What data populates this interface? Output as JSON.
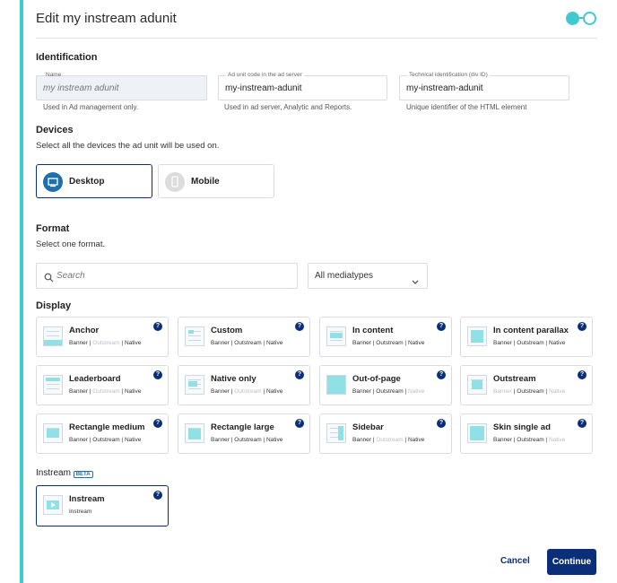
{
  "dialog": {
    "title": "Edit my instream adunit"
  },
  "identification": {
    "heading": "Identification",
    "name": {
      "label": "Name",
      "value": "my instream adunit",
      "help": "Used in Ad management only."
    },
    "ad_code": {
      "label": "Ad unit code in the ad server",
      "value": "my-instream-adunit",
      "help": "Used in ad server, Analytic and Reports."
    },
    "tech_id": {
      "label": "Technical identification (div ID)",
      "value": "my-instream-adunit",
      "help": "Unique identifier of the HTML element"
    }
  },
  "devices": {
    "heading": "Devices",
    "subtitle": "Select all the devices the ad unit will be used on.",
    "items": [
      {
        "label": "Desktop",
        "icon": "desktop-icon",
        "selected": true
      },
      {
        "label": "Mobile",
        "icon": "mobile-icon",
        "selected": false
      }
    ]
  },
  "format": {
    "heading": "Format",
    "subtitle": "Select one format.",
    "search_placeholder": "Search",
    "mediatype_select": "All mediatypes",
    "display_heading": "Display",
    "cards": [
      {
        "name": "Anchor",
        "types": [
          [
            "Banner",
            true
          ],
          [
            "Outstream",
            false
          ],
          [
            "Native",
            true
          ]
        ]
      },
      {
        "name": "Custom",
        "types": [
          [
            "Banner",
            true
          ],
          [
            "Outstream",
            true
          ],
          [
            "Native",
            true
          ]
        ]
      },
      {
        "name": "In content",
        "types": [
          [
            "Banner",
            true
          ],
          [
            "Outstream",
            true
          ],
          [
            "Native",
            true
          ]
        ]
      },
      {
        "name": "In content parallax",
        "types": [
          [
            "Banner",
            true
          ],
          [
            "Outstream",
            true
          ],
          [
            "Native",
            true
          ]
        ]
      },
      {
        "name": "Leaderboard",
        "types": [
          [
            "Banner",
            true
          ],
          [
            "Outstream",
            false
          ],
          [
            "Native",
            true
          ]
        ]
      },
      {
        "name": "Native only",
        "types": [
          [
            "Banner",
            true
          ],
          [
            "Outstream",
            false
          ],
          [
            "Native",
            true
          ]
        ]
      },
      {
        "name": "Out-of-page",
        "types": [
          [
            "Banner",
            true
          ],
          [
            "Outstream",
            true
          ],
          [
            "Native",
            false
          ]
        ]
      },
      {
        "name": "Outstream",
        "types": [
          [
            "Banner",
            false
          ],
          [
            "Outstream",
            true
          ],
          [
            "Native",
            false
          ]
        ]
      },
      {
        "name": "Rectangle medium",
        "types": [
          [
            "Banner",
            true
          ],
          [
            "Outstream",
            true
          ],
          [
            "Native",
            true
          ]
        ]
      },
      {
        "name": "Rectangle large",
        "types": [
          [
            "Banner",
            true
          ],
          [
            "Outstream",
            true
          ],
          [
            "Native",
            true
          ]
        ]
      },
      {
        "name": "Sidebar",
        "types": [
          [
            "Banner",
            true
          ],
          [
            "Outstream",
            false
          ],
          [
            "Native",
            true
          ]
        ]
      },
      {
        "name": "Skin single ad",
        "types": [
          [
            "Banner",
            true
          ],
          [
            "Outstream",
            true
          ],
          [
            "Native",
            false
          ]
        ]
      }
    ],
    "instream_heading": "Instream",
    "instream_badge": "BETA",
    "instream_card": {
      "name": "Instream",
      "types": "Instream"
    }
  },
  "footer": {
    "cancel": "Cancel",
    "continue": "Continue"
  },
  "colors": {
    "accent": "#3fcad0",
    "primary": "#0b2e79"
  }
}
